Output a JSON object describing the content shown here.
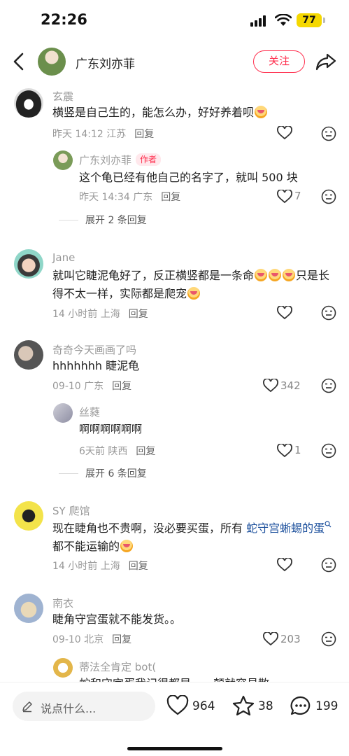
{
  "status_bar": {
    "time": "22:26",
    "battery": "77"
  },
  "header": {
    "username": "广东刘亦菲",
    "follow_label": "关注"
  },
  "comments": [
    {
      "author": "玄震",
      "text": "横竖是自己生的，能怎么办，好好养着呗",
      "date": "昨天 14:12",
      "location": "江苏",
      "reply_label": "回复",
      "likes": ""
    },
    {
      "author": "广东刘亦菲",
      "badge": "作者",
      "text": "这个龟已经有他自己的名字了，就叫 500 块",
      "date": "昨天 14:34",
      "location": "广东",
      "reply_label": "回复",
      "likes": "7"
    },
    {
      "expand_label": "展开 2 条回复"
    },
    {
      "author": "Jane",
      "text_line1": "就叫它睫泥龟好了，反正横竖都是一条命",
      "text_line1b": "只是长",
      "text_line2": "得不太一样，实际都是爬宠",
      "date": "14 小时前",
      "location": "上海",
      "reply_label": "回复",
      "likes": ""
    },
    {
      "author": "奇奇今天画画了吗",
      "text": "hhhhhhh 睫泥龟",
      "date": "09-10",
      "location": "广东",
      "reply_label": "回复",
      "likes": "342"
    },
    {
      "author": "丝蕤",
      "text": "啊啊啊啊啊啊",
      "date": "6天前",
      "location": "陕西",
      "reply_label": "回复",
      "likes": "1"
    },
    {
      "expand_label": "展开 6 条回复"
    },
    {
      "author": "SY 爬馆",
      "text_pre": "现在睫角也不贵啊，没必要买蛋，所有",
      "hashtag": "蛇守宫蜥蜴的蛋",
      "text_line2": "都不能运输的",
      "date": "14 小时前",
      "location": "上海",
      "reply_label": "回复",
      "likes": ""
    },
    {
      "author": "南衣",
      "text": "睫角守宫蛋就不能发货。。",
      "date": "09-10",
      "location": "北京",
      "reply_label": "回复",
      "likes": "203"
    },
    {
      "author": "蒂法全肯定 bot(",
      "text": "蛇和守宫蛋我记得都是，一颠就容易散"
    }
  ],
  "bottom_bar": {
    "input_placeholder": "说点什么...",
    "likes": "964",
    "stars": "38",
    "comments": "199"
  }
}
